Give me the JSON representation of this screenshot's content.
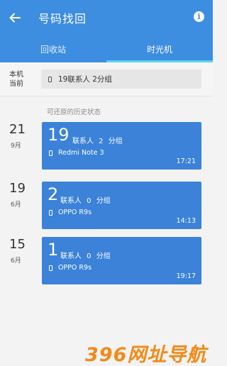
{
  "appbar": {
    "title": "号码找回",
    "back_icon": "arrow-left-icon",
    "info_icon": "info-icon",
    "info_glyph": "i"
  },
  "tabs": [
    {
      "label": "回收站",
      "active": false
    },
    {
      "label": "时光机",
      "active": true
    }
  ],
  "local": {
    "label": "本机 当前",
    "summary": "19联系人  2分组"
  },
  "history_label": "可还原的历史状态",
  "snapshots": [
    {
      "day": "21",
      "month": "9月",
      "count": "19",
      "meta": "联系人 2 分组",
      "device": "Redmi Note 3",
      "time": "17:21"
    },
    {
      "day": "19",
      "month": "6月",
      "count": "2",
      "meta": "联系人 0 分组",
      "device": "OPPO R9s",
      "time": "14:13"
    },
    {
      "day": "15",
      "month": "6月",
      "count": "1",
      "meta": "联系人 0 分组",
      "device": "OPPO R9s",
      "time": "19:17"
    }
  ],
  "watermark": "396网址导航",
  "colors": {
    "primary": "#3d8de0",
    "card": "#3b82d8",
    "indicator": "#5ad4ee",
    "watermark": "#f28a18"
  }
}
